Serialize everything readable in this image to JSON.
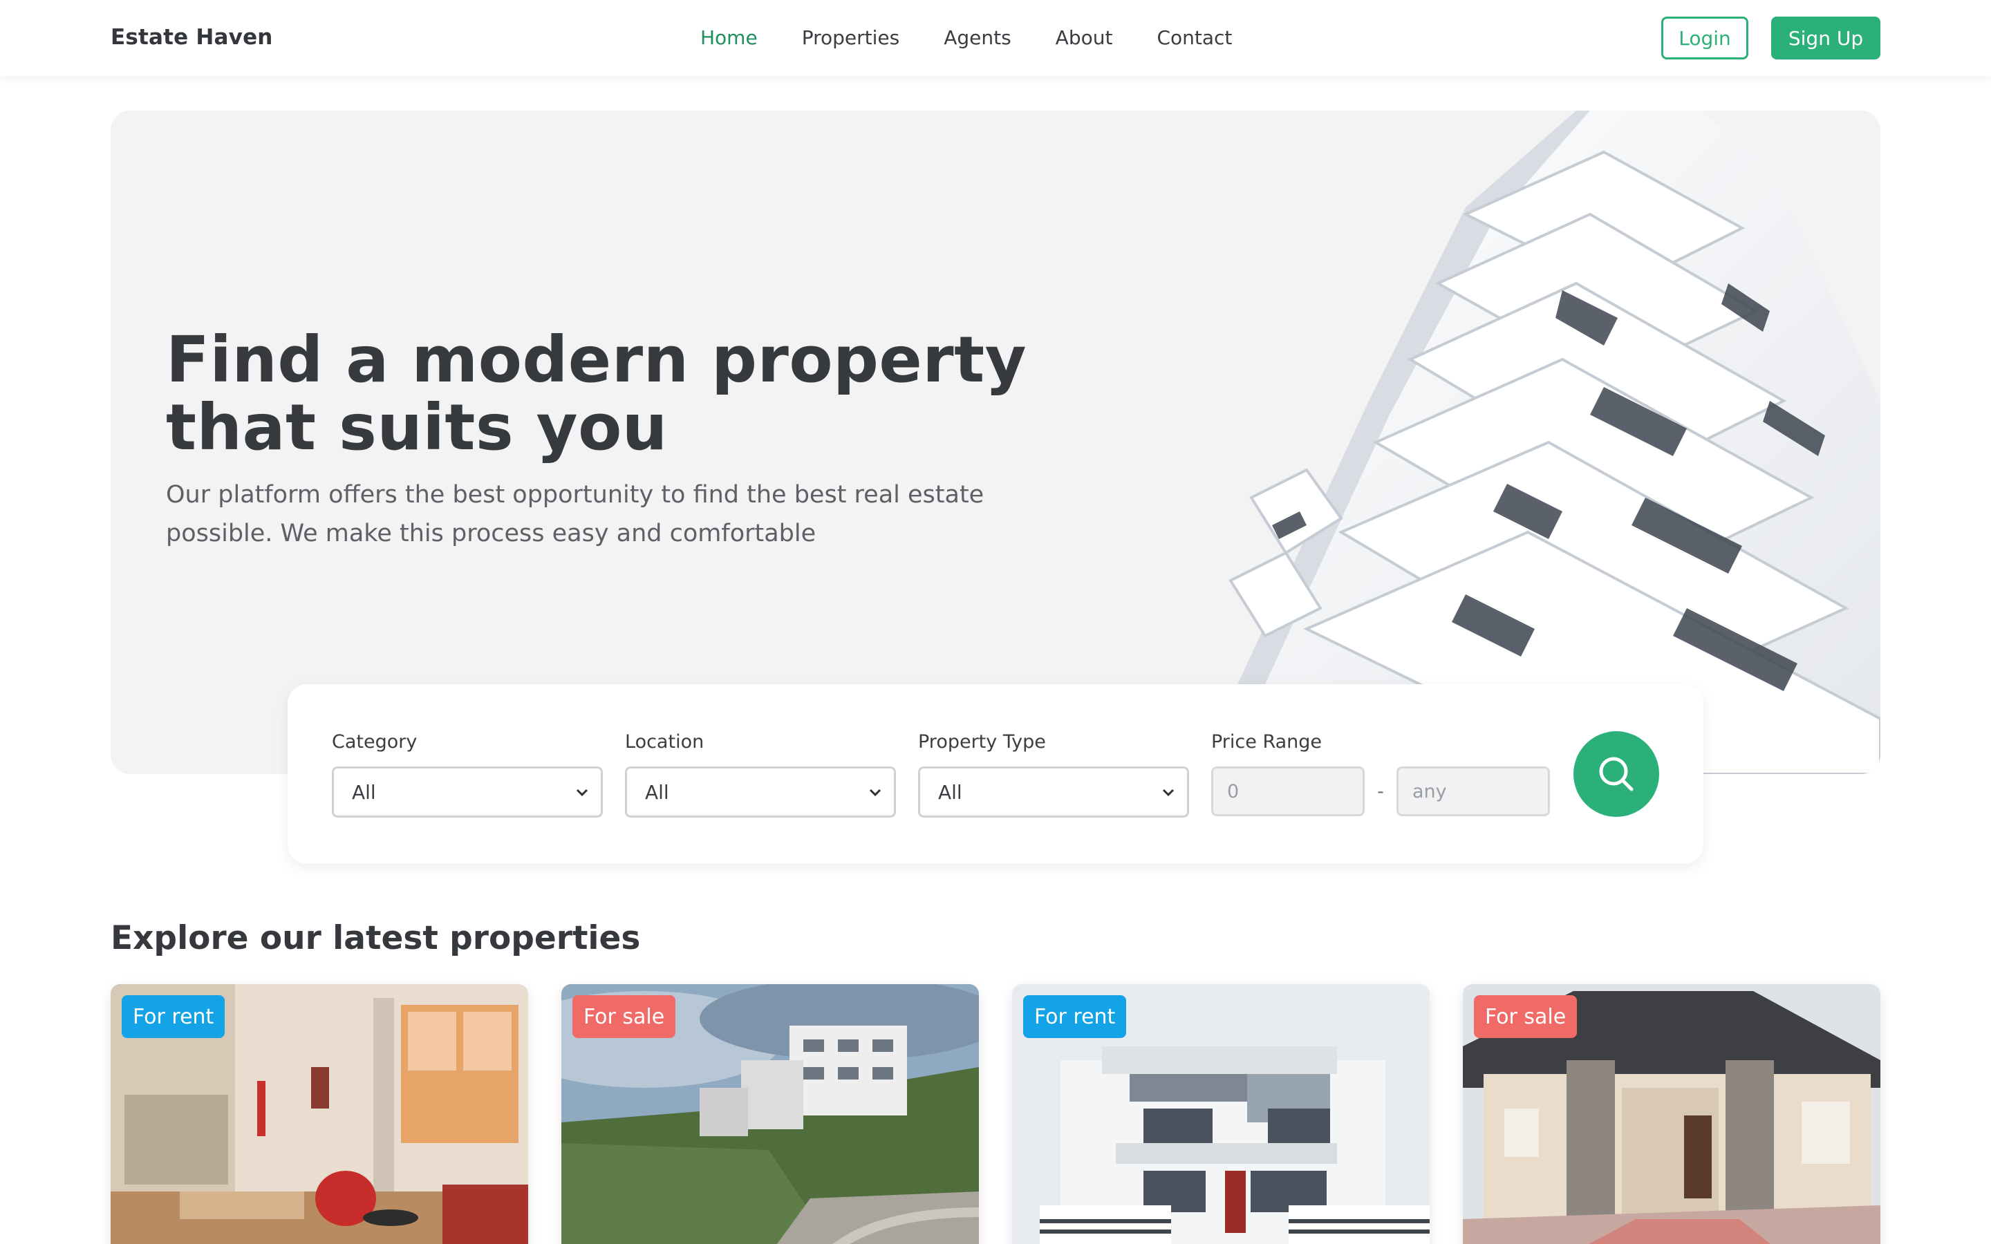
{
  "brand": "Estate Haven",
  "nav": {
    "links": [
      "Home",
      "Properties",
      "Agents",
      "About",
      "Contact"
    ],
    "active": "Home",
    "login_label": "Login",
    "signup_label": "Sign Up"
  },
  "hero": {
    "title": "Find a modern property that suits you",
    "subtitle": "Our platform offers the best opportunity to find the best real estate possible. We make this process easy and comfortable"
  },
  "search": {
    "category": {
      "label": "Category",
      "value": "All"
    },
    "location": {
      "label": "Location",
      "value": "All"
    },
    "property_type": {
      "label": "Property Type",
      "value": "All"
    },
    "price_range": {
      "label": "Price Range",
      "min_placeholder": "0",
      "max_placeholder": "any",
      "separator": "-"
    },
    "button_icon": "search-icon"
  },
  "latest": {
    "title": "Explore our latest properties",
    "cards": [
      {
        "badge": "For rent",
        "image": "apartment-living-room"
      },
      {
        "badge": "For sale",
        "image": "hillside-apartments"
      },
      {
        "badge": "For rent",
        "image": "modern-white-villa"
      },
      {
        "badge": "For sale",
        "image": "brick-bungalow"
      }
    ]
  },
  "colors": {
    "accent": "#2bb07a",
    "active_link": "#1f8f5d",
    "rent_badge": "#13a3e6",
    "sale_badge": "#f06b67",
    "hero_bg": "#f3f3f3"
  }
}
